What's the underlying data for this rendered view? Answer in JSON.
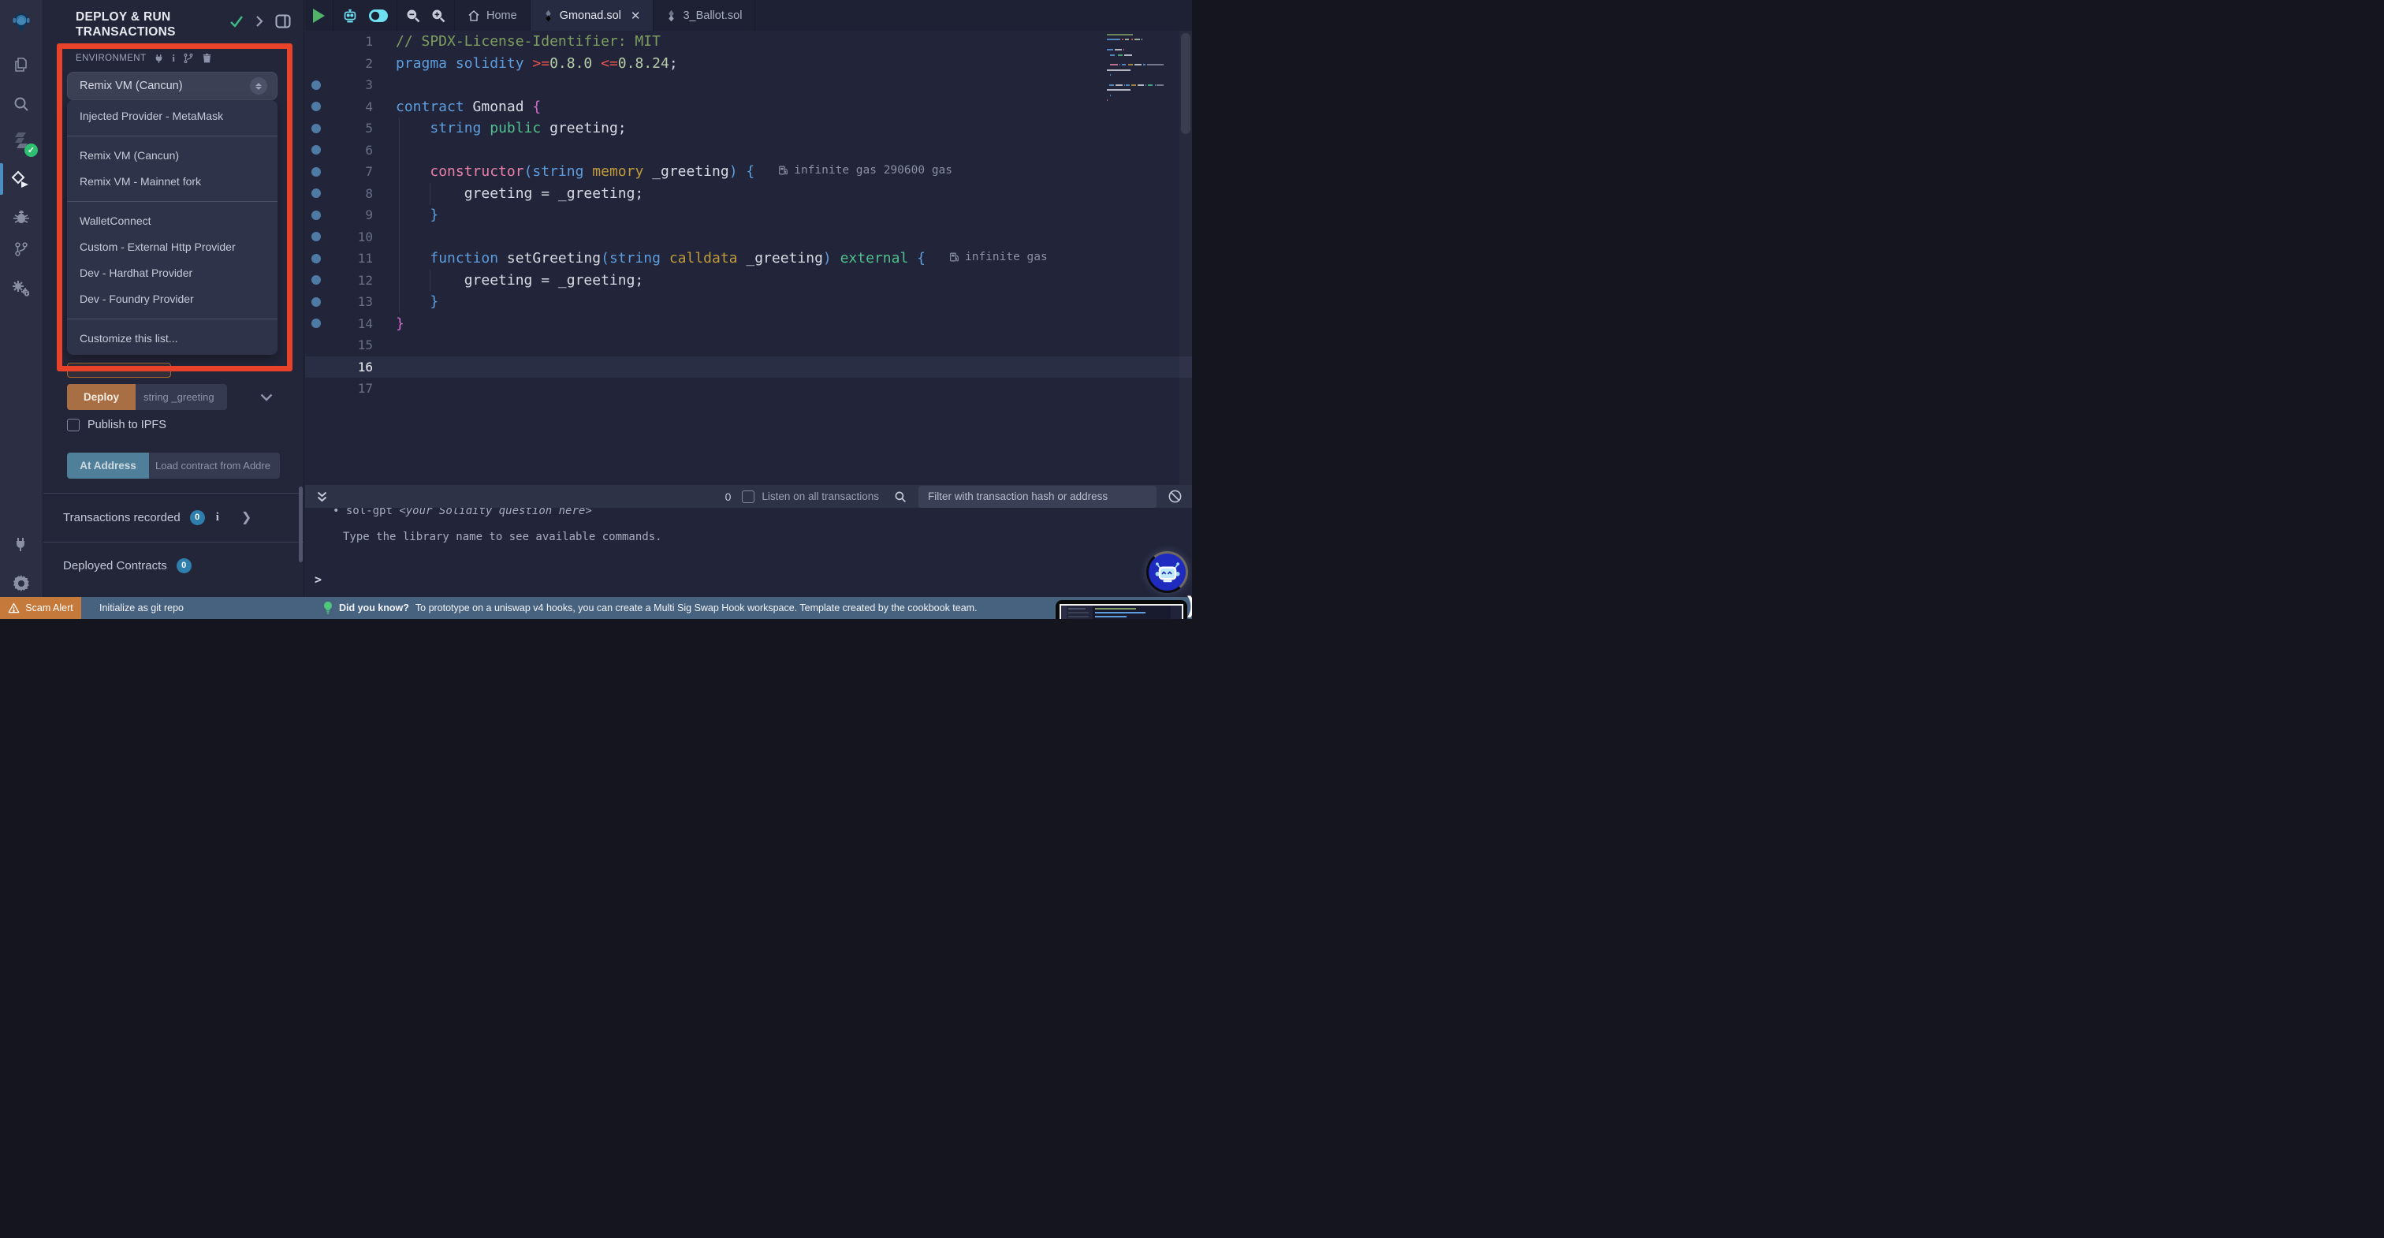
{
  "panel": {
    "title": "DEPLOY & RUN TRANSACTIONS",
    "environment_label": "ENVIRONMENT",
    "selected_environment": "Remix VM (Cancun)",
    "dropdown_groups": [
      [
        "Injected Provider - MetaMask"
      ],
      [
        "Remix VM (Cancun)",
        "Remix VM - Mainnet fork"
      ],
      [
        "WalletConnect",
        "Custom - External Http Provider",
        "Dev - Hardhat Provider",
        "Dev - Foundry Provider"
      ],
      [
        "Customize this list..."
      ]
    ],
    "deploy_button": "Deploy",
    "deploy_placeholder": "string _greeting",
    "publish_label": "Publish to IPFS",
    "at_address_button": "At Address",
    "at_address_placeholder": "Load contract from Addre",
    "transactions_recorded_label": "Transactions recorded",
    "transactions_recorded_count": "0",
    "deployed_contracts_label": "Deployed Contracts",
    "deployed_contracts_count": "0"
  },
  "tabs": {
    "home": "Home",
    "file1": "Gmonad.sol",
    "file2": "3_Ballot.sol"
  },
  "code": {
    "lines": [
      {
        "n": 1,
        "dot": false,
        "tokens": [
          [
            "cmt",
            "// SPDX-License-Identifier: MIT"
          ]
        ]
      },
      {
        "n": 2,
        "dot": false,
        "tokens": [
          [
            "kw",
            "pragma solidity "
          ],
          [
            "op",
            ">="
          ],
          [
            "num",
            "0.8.0"
          ],
          [
            "pln",
            " "
          ],
          [
            "op",
            "<="
          ],
          [
            "num",
            "0.8.24"
          ],
          [
            "pln",
            ";"
          ]
        ]
      },
      {
        "n": 3,
        "dot": true,
        "tokens": []
      },
      {
        "n": 4,
        "dot": true,
        "tokens": [
          [
            "kw",
            "contract"
          ],
          [
            "pln",
            " Gmonad "
          ],
          [
            "mag",
            "{"
          ]
        ]
      },
      {
        "n": 5,
        "dot": true,
        "tokens": [
          [
            "pln",
            "    "
          ],
          [
            "kw",
            "string"
          ],
          [
            "pln",
            " "
          ],
          [
            "grn",
            "public"
          ],
          [
            "pln",
            " greeting;"
          ]
        ]
      },
      {
        "n": 6,
        "dot": true,
        "tokens": []
      },
      {
        "n": 7,
        "dot": true,
        "tokens": [
          [
            "pln",
            "    "
          ],
          [
            "pink",
            "constructor"
          ],
          [
            "kw",
            "("
          ],
          [
            "kw",
            "string"
          ],
          [
            "pln",
            " "
          ],
          [
            "gold",
            "memory"
          ],
          [
            "pln",
            " _greeting"
          ],
          [
            "kw",
            ") {"
          ]
        ],
        "gas": "infinite gas 290600 gas"
      },
      {
        "n": 8,
        "dot": true,
        "tokens": [
          [
            "pln",
            "        greeting = _greeting;"
          ]
        ]
      },
      {
        "n": 9,
        "dot": true,
        "tokens": [
          [
            "pln",
            "    "
          ],
          [
            "kw",
            "}"
          ]
        ]
      },
      {
        "n": 10,
        "dot": true,
        "tokens": []
      },
      {
        "n": 11,
        "dot": true,
        "tokens": [
          [
            "pln",
            "    "
          ],
          [
            "kw",
            "function"
          ],
          [
            "pln",
            " setGreeting"
          ],
          [
            "kw",
            "("
          ],
          [
            "kw",
            "string"
          ],
          [
            "pln",
            " "
          ],
          [
            "gold",
            "calldata"
          ],
          [
            "pln",
            " _greeting"
          ],
          [
            "kw",
            ")"
          ],
          [
            "pln",
            " "
          ],
          [
            "grn",
            "external"
          ],
          [
            "pln",
            " "
          ],
          [
            "kw",
            "{"
          ]
        ],
        "gas": "infinite gas"
      },
      {
        "n": 12,
        "dot": true,
        "tokens": [
          [
            "pln",
            "        greeting = _greeting;"
          ]
        ]
      },
      {
        "n": 13,
        "dot": true,
        "tokens": [
          [
            "pln",
            "    "
          ],
          [
            "kw",
            "}"
          ]
        ]
      },
      {
        "n": 14,
        "dot": true,
        "tokens": [
          [
            "mag",
            "}"
          ]
        ]
      },
      {
        "n": 15,
        "dot": false,
        "tokens": []
      },
      {
        "n": 16,
        "dot": false,
        "active": true,
        "tokens": []
      },
      {
        "n": 17,
        "dot": false,
        "tokens": []
      }
    ]
  },
  "terminal": {
    "count": "0",
    "listen_label": "Listen on all transactions",
    "filter_placeholder": "Filter with transaction hash or address",
    "line1_bullet": "•",
    "line1_cmd": "sol-gpt ",
    "line1_arg": "<your Solidity question here>",
    "line2": "Type the library name to see available commands.",
    "prompt": ">"
  },
  "status_bar": {
    "scam_alert": "Scam Alert",
    "git_init": "Initialize as git repo",
    "did_you_know": "Did you know?",
    "tip": "To prototype on a uniswap v4 hooks, you can create a Multi Sig Swap Hook workspace. Template created by the cookbook team.",
    "right_fragment": ")"
  },
  "colors": {
    "accent_red": "#e8432a",
    "badge_blue": "#2f7fae",
    "status_bar": "#46627f",
    "scam_orange": "#c5793a",
    "deploy_brown": "#a96f44",
    "at_address_blue": "#4f7f99",
    "token_colors": {
      "pln": "#d8dae3",
      "cmt": "#7d9e60",
      "kw": "#5e9ddd",
      "num": "#b5cea8",
      "op": "#ef5350",
      "grn": "#4fc08d",
      "pink": "#e880a8",
      "gold": "#c09b3a",
      "mag": "#d16dca",
      "gas": "#8a8fa3"
    }
  }
}
